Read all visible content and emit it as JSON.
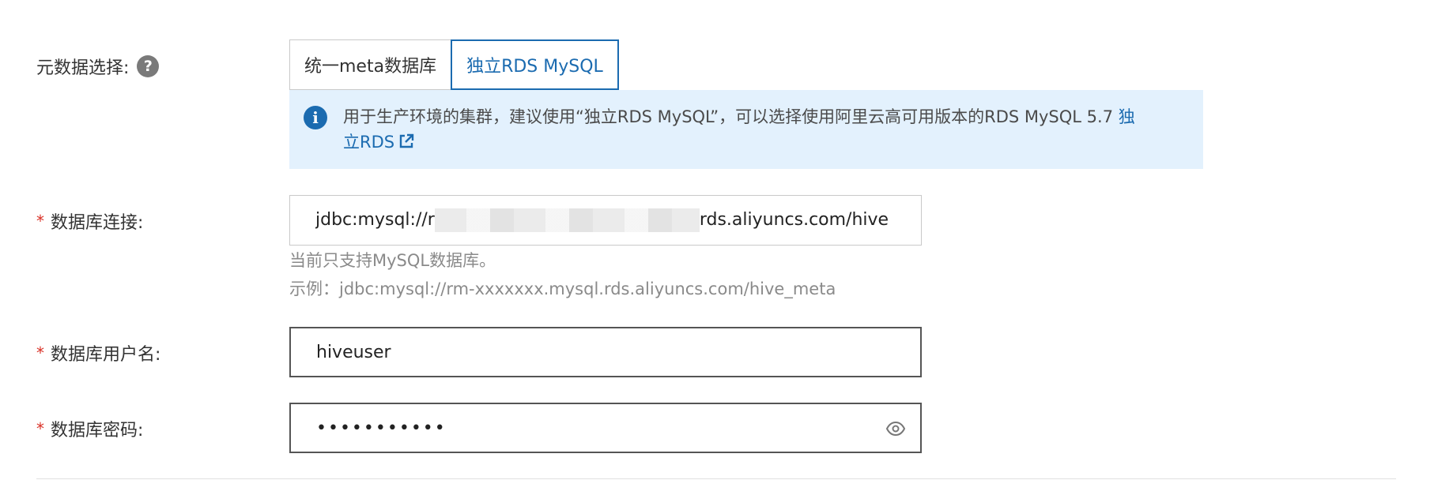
{
  "metadata_select": {
    "label": "元数据选择:",
    "help_icon": "?",
    "options": [
      "统一meta数据库",
      "独立RDS MySQL"
    ],
    "selected": "独立RDS MySQL"
  },
  "notice": {
    "text": "用于生产环境的集群，建议使用“独立RDS MySQL”，可以选择使用阿里云高可用版本的RDS MySQL 5.7",
    "link_text": "独立RDS"
  },
  "db_connection": {
    "required_mark": "*",
    "label": "数据库连接:",
    "value_prefix": "jdbc:mysql://r",
    "value_suffix": "rds.aliyuncs.com/hive",
    "hint_line1": "当前只支持MySQL数据库。",
    "hint_line2": "示例：jdbc:mysql://rm-xxxxxxx.mysql.rds.aliyuncs.com/hive_meta"
  },
  "db_username": {
    "required_mark": "*",
    "label": "数据库用户名:",
    "value": "hiveuser"
  },
  "db_password": {
    "required_mark": "*",
    "label": "数据库密码:",
    "value": "•••••••••••",
    "toggle_icon": "eye-icon"
  },
  "colors": {
    "accent": "#1b6bb0",
    "notice_bg": "#e3f1fd",
    "required": "#d93026"
  }
}
